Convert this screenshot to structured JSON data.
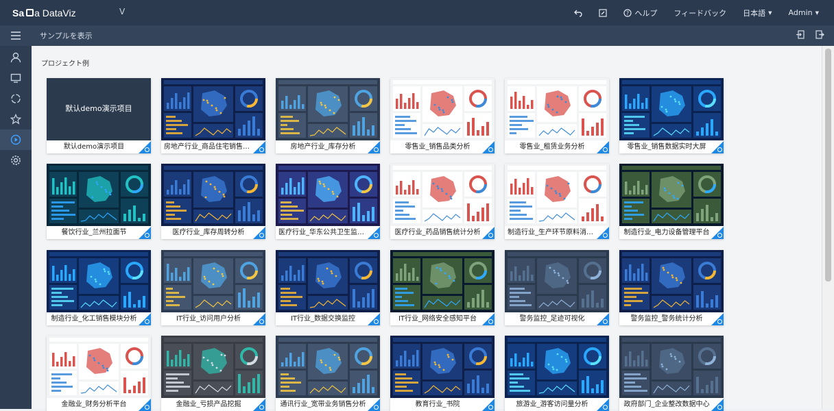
{
  "app": {
    "logo_bold": "Sa",
    "logo_mid": "C",
    "logo_rest": "a DataViz",
    "version": "V"
  },
  "topbar": {
    "help": "ヘルプ",
    "feedback": "フィードバック",
    "language": "日本語",
    "user": "Admin"
  },
  "subbar": {
    "title": "サンプルを表示"
  },
  "section": {
    "title": "プロジェクト例"
  },
  "colors": {
    "topbar": "#2b3a4f",
    "badge": "#1e88e5"
  },
  "projects": [
    {
      "caption": "默认demo演示项目",
      "overlay": "默认demo演示项目",
      "theme": "dark"
    },
    {
      "caption": "房地产行业_商品住宅销售分析",
      "theme": "navy"
    },
    {
      "caption": "房地产行业_库存分析",
      "theme": "slate"
    },
    {
      "caption": "零售业_销售品类分析",
      "theme": "light"
    },
    {
      "caption": "零售业_租赁业务分析",
      "theme": "light"
    },
    {
      "caption": "零售业_销售数据实时大屏",
      "theme": "blue"
    },
    {
      "caption": "餐饮行业_兰州拉面节",
      "theme": "teal"
    },
    {
      "caption": "医疗行业_库存周转分析",
      "theme": "navy"
    },
    {
      "caption": "医疗行业_华东公共卫生监管平台",
      "theme": "purple"
    },
    {
      "caption": "医疗行业_药品销售统计分析",
      "theme": "light"
    },
    {
      "caption": "制造行业_生产环节原料消耗分析",
      "theme": "light"
    },
    {
      "caption": "制造行业_电力设备管理平台",
      "theme": "earth"
    },
    {
      "caption": "制造行业_化工销售模块分析",
      "theme": "blue"
    },
    {
      "caption": "IT行业_访问用户分析",
      "theme": "slate"
    },
    {
      "caption": "IT行业_数据交换监控",
      "theme": "navy"
    },
    {
      "caption": "IT行业_网络安全感知平台",
      "theme": "earth"
    },
    {
      "caption": "警务监控_足迹可视化",
      "theme": "dark"
    },
    {
      "caption": "警务监控_警务统计分析",
      "theme": "navy"
    },
    {
      "caption": "金融业_财务分析平台",
      "theme": "light"
    },
    {
      "caption": "金融业_亏损产品挖掘",
      "theme": "grey"
    },
    {
      "caption": "通讯行业_宽带业务销售分析",
      "theme": "slate"
    },
    {
      "caption": "教育行业_书院",
      "theme": "navy"
    },
    {
      "caption": "旅游业_游客访问量分析",
      "theme": "blue"
    },
    {
      "caption": "政府部门_企业整改数据中心",
      "theme": "dark"
    }
  ]
}
